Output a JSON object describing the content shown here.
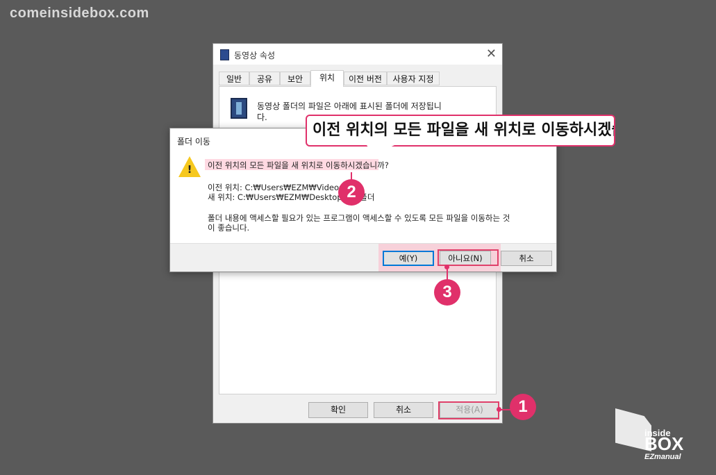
{
  "watermark": "comeinsidebox.com",
  "properties_window": {
    "title": "동영상 속성",
    "close_glyph": "✕",
    "tabs": [
      {
        "label": "일반"
      },
      {
        "label": "공유"
      },
      {
        "label": "보안"
      },
      {
        "label": "위치",
        "active": true
      },
      {
        "label": "이전 버전"
      },
      {
        "label": "사용자 지정"
      }
    ],
    "description_line1": "동영상 폴더의 파일은 아래에 표시된 폴더에 저장됩니",
    "description_line2": "다.",
    "buttons": {
      "ok": "확인",
      "cancel": "취소",
      "apply": "적용(A)"
    }
  },
  "dialog": {
    "title": "폴더 이동",
    "question": "이전 위치의 모든 파일을 새 위치로 이동하시겠습니까?",
    "old_location": "이전 위치: C:₩Users₩EZM₩Videos",
    "new_location": "새 위치: C:₩Users₩EZM₩Desktop₩새 폴더",
    "advice_line1": "폴더 내용에 액세스할 필요가 있는 프로그램이 액세스할 수 있도록 모든 파일을 이동하는 것",
    "advice_line2": "이 좋습니다.",
    "buttons": {
      "yes": "예(Y)",
      "no": "아니요(N)",
      "cancel": "취소"
    }
  },
  "callout_text": "이전 위치의 모든 파일을 새 위치로 이동하시겠습니까?",
  "badges": {
    "b1": "1",
    "b2": "2",
    "b3": "3"
  },
  "logo": {
    "line1": "inside",
    "line2": "BOX",
    "line3": "EZmanual"
  },
  "colors": {
    "accent": "#e0306a",
    "background": "#5a5a5a",
    "warning": "#f6c81e",
    "focus": "#0078d7"
  }
}
